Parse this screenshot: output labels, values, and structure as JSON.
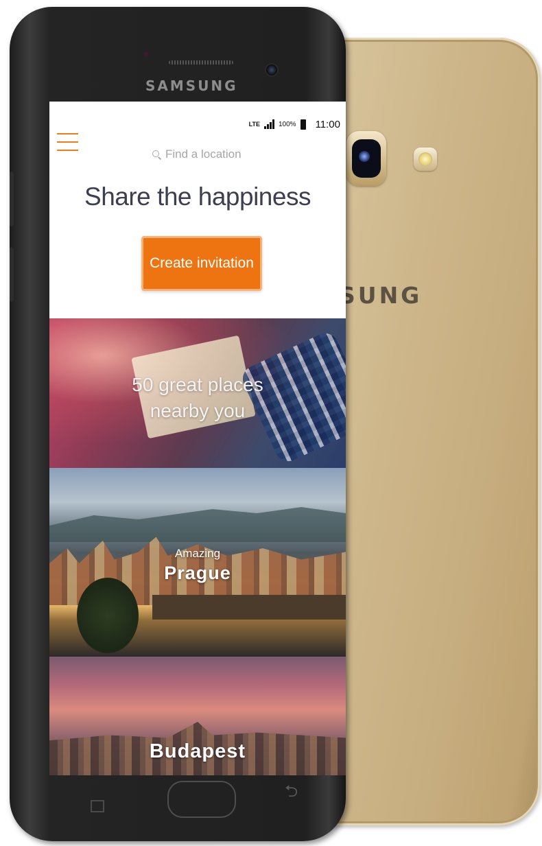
{
  "device": {
    "front_brand": "SAMSUNG",
    "back_brand": "SUNG",
    "body_color": "#c9b184",
    "front_color": "#222222"
  },
  "status_bar": {
    "network": "LTE",
    "battery_percent": "100%",
    "time": "11:00"
  },
  "header": {
    "menu_icon": "hamburger-menu-icon",
    "search": {
      "placeholder": "Find a location",
      "value": ""
    }
  },
  "hero": {
    "headline": "Share the happiness",
    "cta_label": "Create invitation",
    "cta_color": "#ee7411"
  },
  "cards": [
    {
      "title_line1": "50 great places",
      "title_line2": "nearby you"
    },
    {
      "eyebrow": "Amazing",
      "title": "Prague"
    },
    {
      "title": "Budapest"
    }
  ]
}
